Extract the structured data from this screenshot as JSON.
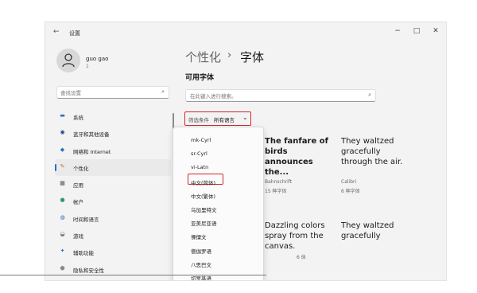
{
  "window": {
    "back_glyph": "←",
    "title": "设置",
    "minimize_glyph": "−",
    "maximize_glyph": "□",
    "close_glyph": "✕"
  },
  "user": {
    "name": "guo gao",
    "sub": "1"
  },
  "left_search": {
    "placeholder": "查找设置",
    "icon": "search-icon",
    "icon_glyph": "⌕"
  },
  "nav": [
    {
      "label": "系统",
      "icon": "monitor-icon",
      "glyph": "▬",
      "color": "#2b6fc4"
    },
    {
      "label": "蓝牙和其他设备",
      "icon": "bluetooth-icon",
      "glyph": "◉",
      "color": "#1d3f8a"
    },
    {
      "label": "网络和 Internet",
      "icon": "wifi-icon",
      "glyph": "◆",
      "color": "#2b6fc4"
    },
    {
      "label": "个性化",
      "icon": "brush-icon",
      "glyph": "✎",
      "color": "#c46b2b",
      "selected": true
    },
    {
      "label": "应用",
      "icon": "apps-icon",
      "glyph": "▦",
      "color": "#555555"
    },
    {
      "label": "帐户",
      "icon": "person-icon",
      "glyph": "●",
      "color": "#2e9a6a"
    },
    {
      "label": "时间和语言",
      "icon": "globe-clock-icon",
      "glyph": "◍",
      "color": "#2b6fc4"
    },
    {
      "label": "游戏",
      "icon": "gamepad-icon",
      "glyph": "◒",
      "color": "#777777"
    },
    {
      "label": "辅助功能",
      "icon": "accessibility-icon",
      "glyph": "✦",
      "color": "#2b6fc4"
    },
    {
      "label": "隐私和安全性",
      "icon": "shield-icon",
      "glyph": "⬟",
      "color": "#888888"
    }
  ],
  "breadcrumb": {
    "parent": "个性化",
    "separator": "›",
    "current": "字体"
  },
  "section_title": "可用字体",
  "main_search": {
    "placeholder": "在此键入进行搜索。",
    "icon": "search-icon",
    "icon_glyph": "⌕"
  },
  "filter": {
    "label": "筛选条件",
    "value": "所有语言",
    "chevron": "⌄"
  },
  "dropdown": {
    "items": [
      "mk-Cyrl",
      "sr-Cyrl",
      "vi-Latn",
      "中文(简体)",
      "中文(繁体)",
      "乌加里特文",
      "亚美尼亚语",
      "傈僳文",
      "僧伽罗语",
      "八思巴文",
      "切罗基语"
    ],
    "selected": "中文(简体)"
  },
  "font_cards": [
    {
      "sample": "The fanfare of birds announces the...",
      "name": "Bahnschrift",
      "count": "15 种字体"
    },
    {
      "sample": "They waltzed gracefully through the air.",
      "name": "Calibri",
      "count": "6 种字体"
    },
    {
      "sample": "Dazzling colors spray from the canvas.",
      "name": "",
      "count": "6 体"
    },
    {
      "sample": "They waltzed gracefully",
      "name": "",
      "count": ""
    }
  ],
  "colors": {
    "accent": "#2b6fc4",
    "highlight_red": "#d3262c"
  }
}
